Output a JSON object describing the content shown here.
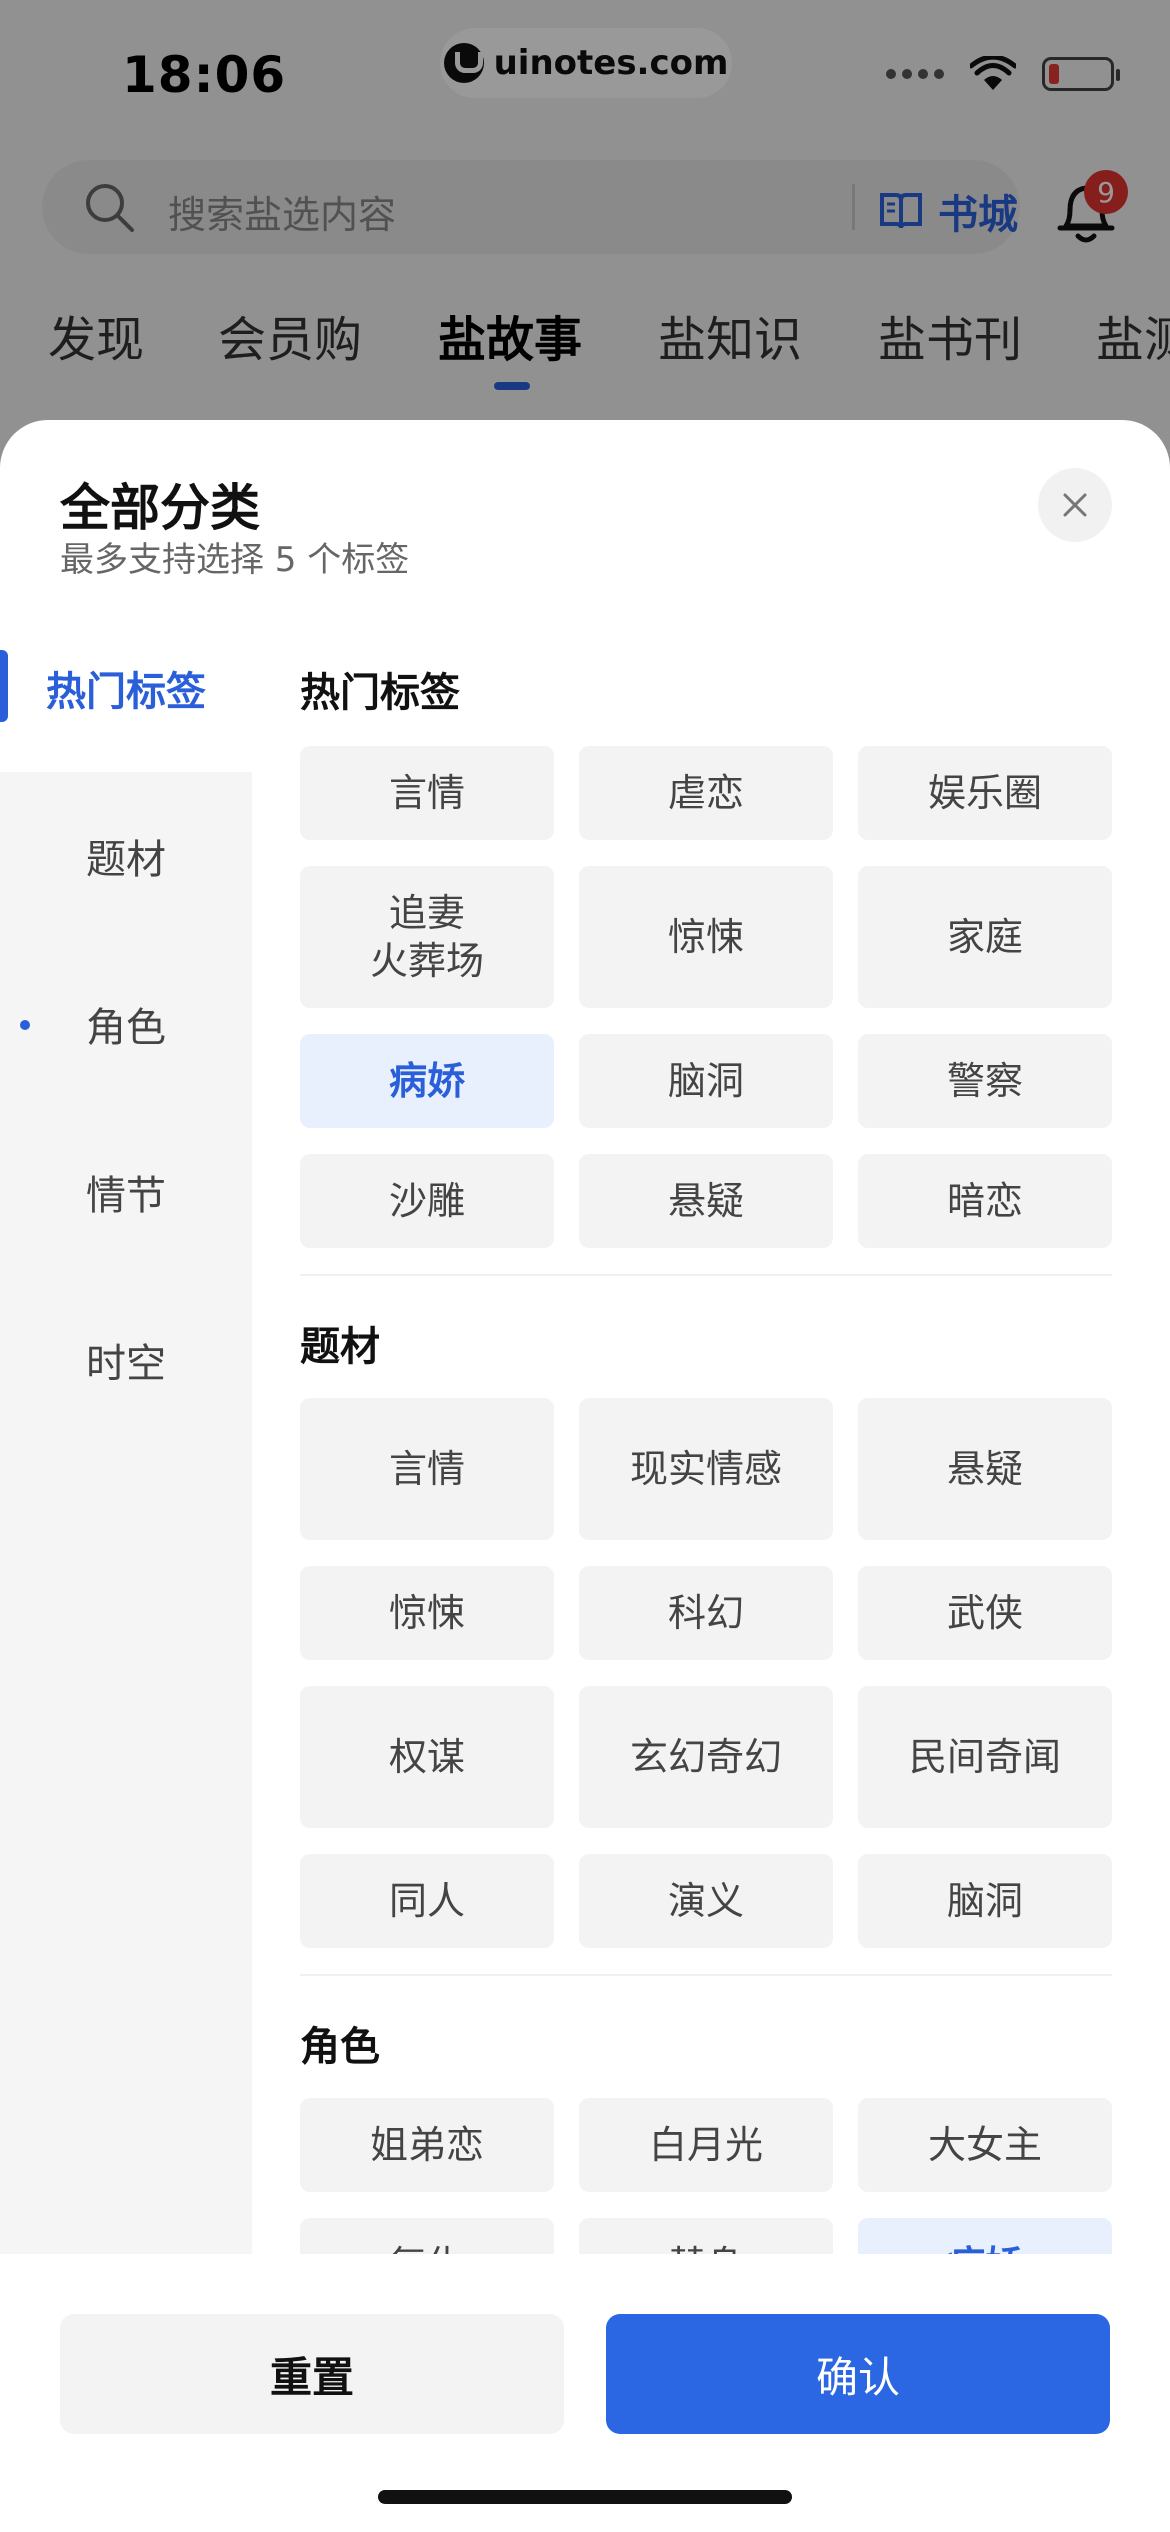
{
  "status": {
    "time": "18:06",
    "watermark": "uinotes.com"
  },
  "search": {
    "placeholder": "搜索盐选内容",
    "bookstore_label": "书城"
  },
  "notifications": {
    "badge": "9"
  },
  "tabs": [
    "发现",
    "会员购",
    "盐故事",
    "盐知识",
    "盐书刊",
    "盐测"
  ],
  "active_tab": "盐故事",
  "sheet": {
    "title": "全部分类",
    "subtitle": "最多支持选择 5 个标签",
    "close_icon": "close-icon",
    "sidebar": [
      {
        "label": "热门标签",
        "active": true
      },
      {
        "label": "题材"
      },
      {
        "label": "角色",
        "dot": true
      },
      {
        "label": "情节"
      },
      {
        "label": "时空"
      }
    ],
    "sections": [
      {
        "title": "热门标签",
        "chips": [
          "言情",
          "虐恋",
          "娱乐圈",
          "追妻\n火葬场",
          "惊悚",
          "家庭",
          "病娇",
          "脑洞",
          "警察",
          "沙雕",
          "悬疑",
          "暗恋"
        ],
        "selected": [
          "病娇"
        ]
      },
      {
        "title": "题材",
        "chips": [
          "言情",
          "现实情感",
          "悬疑",
          "惊悚",
          "科幻",
          "武侠",
          "权谋",
          "玄幻奇幻",
          "民间奇闻",
          "同人",
          "演义",
          "脑洞"
        ]
      },
      {
        "title": "角色",
        "chips": [
          "姐弟恋",
          "白月光",
          "大女主",
          "复仇",
          "替身",
          "病娇"
        ],
        "selected": [
          "病娇"
        ]
      }
    ],
    "buttons": {
      "reset": "重置",
      "confirm": "确认"
    }
  },
  "colors": {
    "accent": "#2b5fd9",
    "selected_bg": "#e8f0fd",
    "chip_bg": "#f3f3f3"
  }
}
